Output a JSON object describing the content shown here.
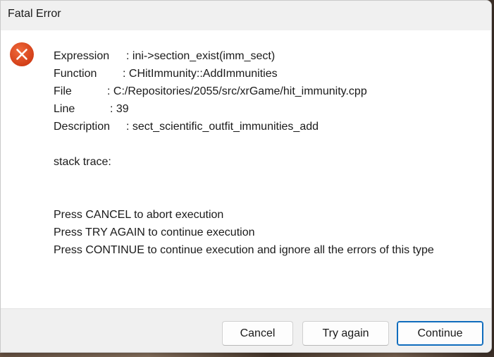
{
  "window": {
    "title": "Fatal Error"
  },
  "icon": {
    "name": "error-icon",
    "color": "#d9411b"
  },
  "message": {
    "expression_label": "Expression",
    "expression_value": ": ini->section_exist(imm_sect)",
    "function_label": "Function",
    "function_value": ": CHitImmunity::AddImmunities",
    "file_label": "File",
    "file_value": ": C:/Repositories/2055/src/xrGame/hit_immunity.cpp",
    "line_label": "Line",
    "line_value": ": 39",
    "description_label": "Description",
    "description_value": ": sect_scientific_outfit_immunities_add",
    "stack_trace": "stack trace:",
    "instructions": [
      "Press CANCEL to abort execution",
      "Press TRY AGAIN to continue execution",
      "Press CONTINUE to continue execution and ignore all the errors of this type"
    ]
  },
  "buttons": {
    "cancel": "Cancel",
    "try_again": "Try again",
    "continue": "Continue"
  },
  "colors": {
    "default_button_border": "#0f6cbd",
    "titlebar": "#f0f0f0",
    "footer": "#f0f0f0"
  }
}
